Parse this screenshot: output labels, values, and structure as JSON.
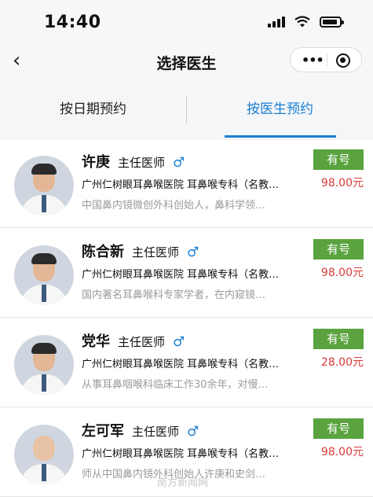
{
  "status_bar": {
    "time": "14:40"
  },
  "nav": {
    "back_icon": "‹",
    "title": "选择医生",
    "more_icon": "•••"
  },
  "tabs": [
    {
      "label": "按日期预约",
      "active": false
    },
    {
      "label": "按医生预约",
      "active": true
    }
  ],
  "colors": {
    "accent": "#1a7fd4",
    "badge": "#5aa33f",
    "price": "#d93b36"
  },
  "doctors": [
    {
      "name": "许庚",
      "title": "主任医师",
      "gender": "♂",
      "hospital": "广州仁树眼耳鼻喉医院  耳鼻喉专科（名教…",
      "intro": "中国鼻内镜微创外科创始人，鼻科学领…",
      "status": "有号",
      "price": "98.00元"
    },
    {
      "name": "陈合新",
      "title": "主任医师",
      "gender": "♂",
      "hospital": "广州仁树眼耳鼻喉医院  耳鼻喉专科（名教…",
      "intro": "国内著名耳鼻喉科专家学者，在内窥镜…",
      "status": "有号",
      "price": "98.00元"
    },
    {
      "name": "党华",
      "title": "主任医师",
      "gender": "♂",
      "hospital": "广州仁树眼耳鼻喉医院  耳鼻喉专科（名教…",
      "intro": "从事耳鼻咽喉科临床工作30余年，对慢…",
      "status": "有号",
      "price": "28.00元"
    },
    {
      "name": "左可军",
      "title": "主任医师",
      "gender": "♂",
      "hospital": "广州仁树眼耳鼻喉医院  耳鼻喉专科（名教…",
      "intro": "师从中国鼻内镜外科创始人许庚和史剑…",
      "status": "有号",
      "price": "98.00元"
    }
  ],
  "watermark": "南方新闻网"
}
